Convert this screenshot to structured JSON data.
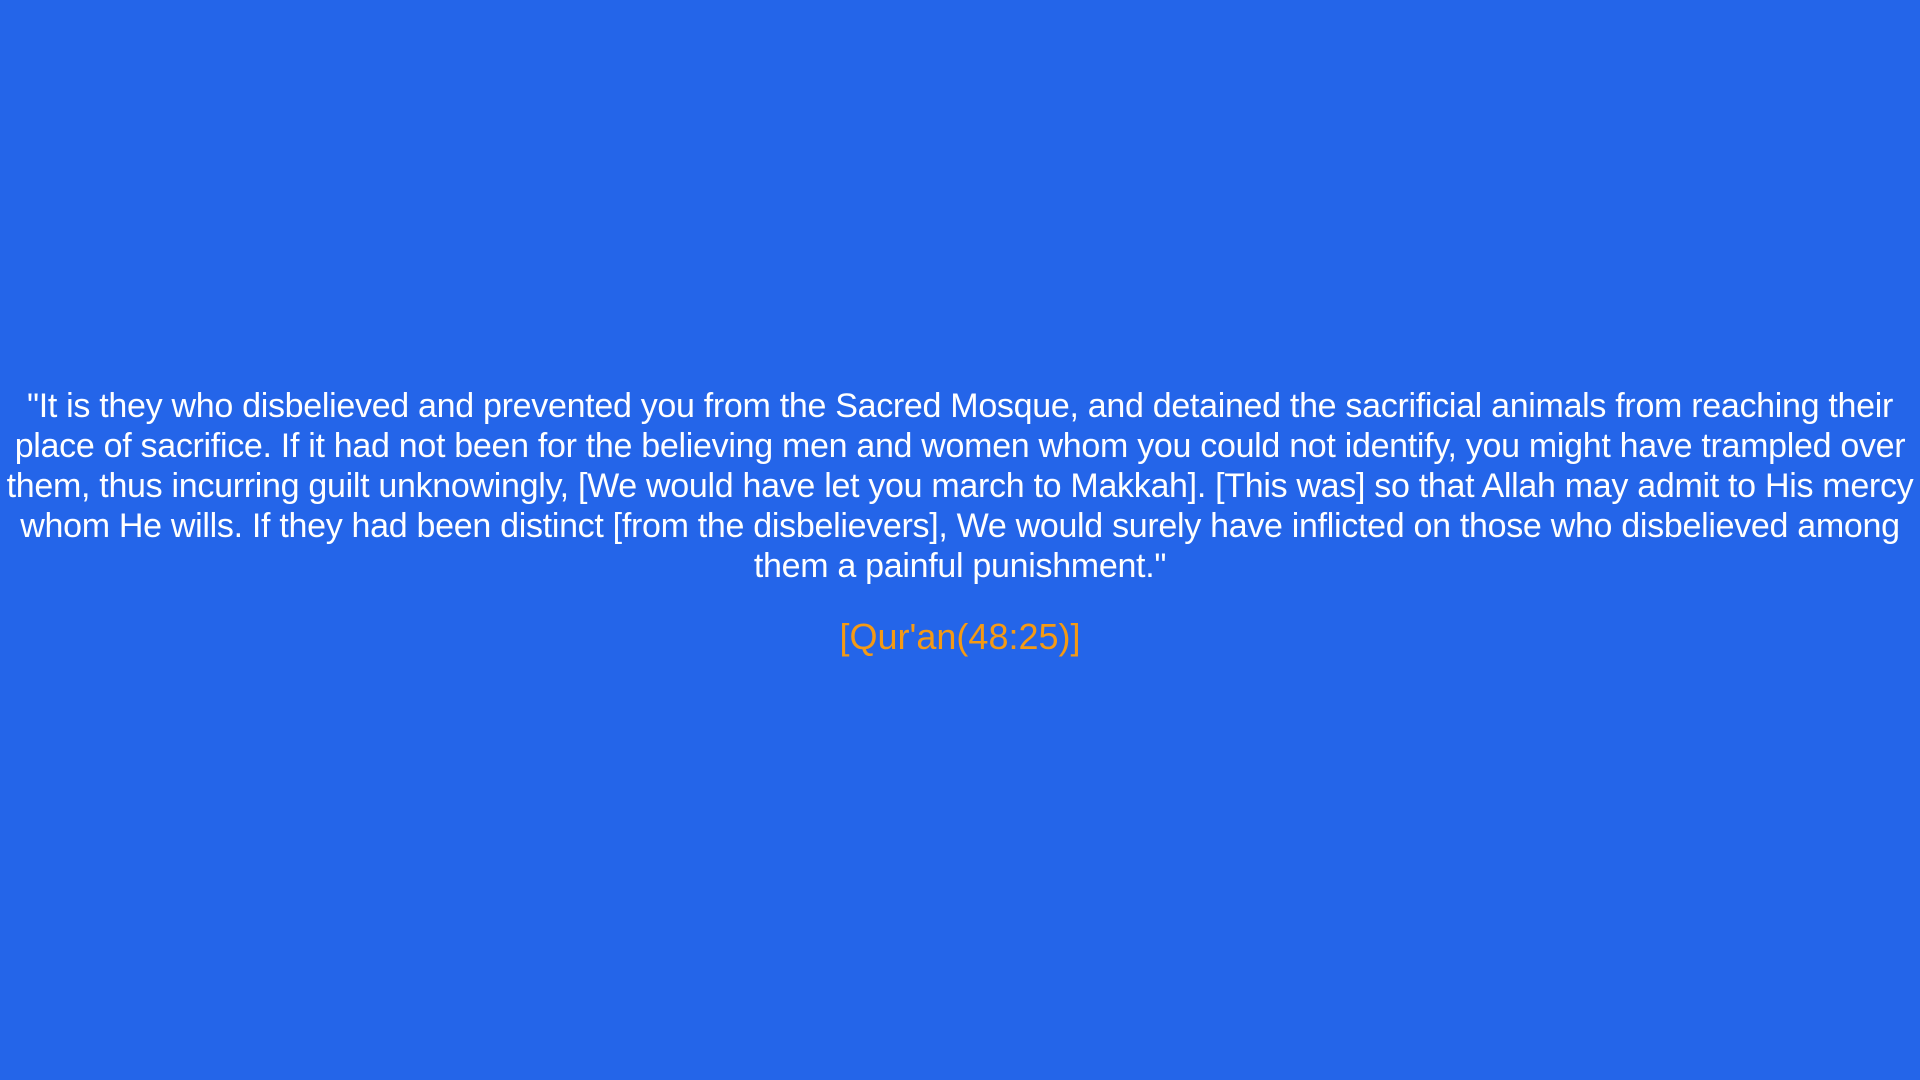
{
  "quote": {
    "text": "\"It is they who disbelieved and prevented you from the Sacred Mosque, and detained the sacrificial animals from reaching their place of sacrifice. If it had not been for the believing men and women whom you could not identify, you might have trampled over them, thus incurring guilt unknowingly, [We would have let you march to Makkah]. [This was] so that Allah may admit to His mercy whom He wills. If they had been distinct [from the disbelievers], We would surely have inflicted on those who disbelieved among them a painful punishment.\"",
    "citation": "[Qur'an(48:25)]"
  },
  "colors": {
    "background": "#2465e9",
    "quote_text": "#ffffff",
    "citation": "#f59a14"
  }
}
